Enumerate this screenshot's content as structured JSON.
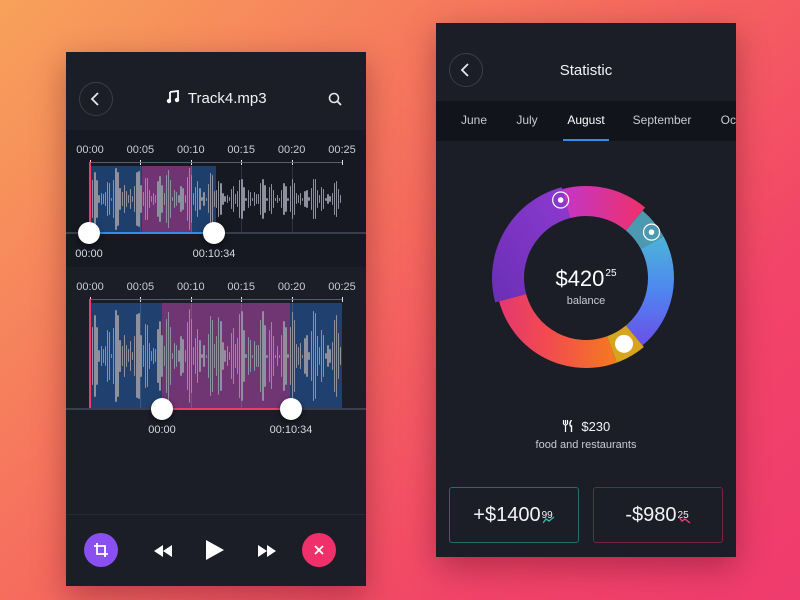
{
  "player": {
    "title": "Track4.mp3",
    "icons": {
      "back": "chevron-left-icon",
      "music": "music-note-icon",
      "search": "search-icon"
    },
    "timeline_ticks": [
      "00:00",
      "00:05",
      "00:10",
      "00:15",
      "00:20",
      "00:25"
    ],
    "clip1": {
      "start_label": "00:00",
      "end_label": "00:10:34"
    },
    "clip2": {
      "start_label": "00:00",
      "end_label": "00:10:34"
    },
    "controls": {
      "crop": "crop-icon",
      "rewind": "rewind-icon",
      "play": "play-icon",
      "forward": "fast-forward-icon",
      "close": "close-icon"
    },
    "colors": {
      "crop_button": "#8a4ff0",
      "close_button": "#f0306a",
      "marker": "#ef3b6e",
      "track": "#2f8fe8"
    }
  },
  "statistic": {
    "title": "Statistic",
    "months": [
      "June",
      "July",
      "August",
      "September",
      "Oct"
    ],
    "active_month": "August",
    "balance": {
      "amount": "$420",
      "cents": "25",
      "label": "balance"
    },
    "category": {
      "amount": "$230",
      "label": "food and restaurants",
      "icon": "fork-knife-icon"
    },
    "income": {
      "amount": "+$1400",
      "cents": "99",
      "icon": "trend-up-icon",
      "color": "#2a6a6a"
    },
    "expense": {
      "amount": "-$980",
      "cents": "25",
      "icon": "trend-down-icon",
      "color": "#7a2340"
    }
  }
}
